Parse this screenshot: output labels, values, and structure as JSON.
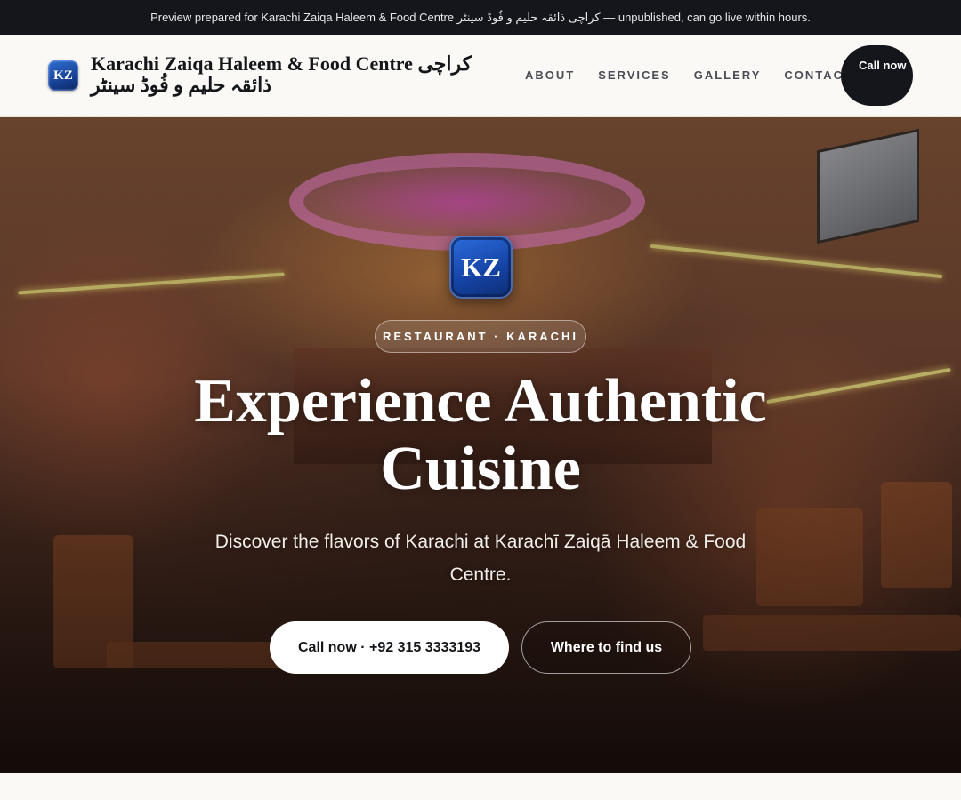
{
  "banner": {
    "text": "Preview prepared for Karachi Zaiqa Haleem & Food Centre کراچی ذائقہ حلیم و فُوڈ سینٹر — unpublished, can go live within hours."
  },
  "header": {
    "logo_text": "KZ",
    "brand_name": "Karachi Zaiqa Haleem & Food Centre کراچی ذائقہ حلیم و فُوڈ سینٹر",
    "nav": [
      "ABOUT",
      "SERVICES",
      "GALLERY",
      "CONTACT"
    ],
    "call_label": "Call now"
  },
  "hero": {
    "logo_text": "KZ",
    "tag": "RESTAURANT · KARACHI",
    "title": "Experience Authentic Cuisine",
    "subtitle": "Discover the flavors of Karachi at Karachī Zaiqā Haleem & Food Centre.",
    "primary_button": "Call now · +92 315 3333193",
    "secondary_button": "Where to find us"
  },
  "colors": {
    "dark": "#14161c",
    "accent_blue": "#1645a8",
    "page_bg": "#faf9f6"
  }
}
